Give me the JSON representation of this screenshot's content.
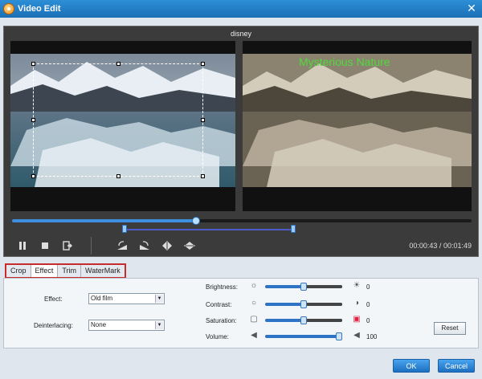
{
  "window": {
    "title": "Video Edit",
    "close_glyph": "✕"
  },
  "preview": {
    "title": "disney",
    "watermark_text": "Mysterious Nature",
    "time_current": "00:00:43",
    "time_separator": "/",
    "time_total": "00:01:49",
    "playback_progress": 0.4
  },
  "tabs": [
    {
      "label": "Crop",
      "active": false
    },
    {
      "label": "Effect",
      "active": true
    },
    {
      "label": "Trim",
      "active": false
    },
    {
      "label": "WaterMark",
      "active": false
    }
  ],
  "effect_panel": {
    "effect_label": "Effect:",
    "effect_value": "Old film",
    "deinterlacing_label": "Deinterlacing:",
    "deinterlacing_value": "None",
    "brightness_label": "Brightness:",
    "brightness_value": "0",
    "brightness_level": 0.5,
    "contrast_label": "Contrast:",
    "contrast_value": "0",
    "contrast_level": 0.5,
    "saturation_label": "Saturation:",
    "saturation_value": "0",
    "saturation_level": 0.5,
    "volume_label": "Volume:",
    "volume_value": "100",
    "volume_level": 1.0,
    "reset_label": "Reset"
  },
  "buttons": {
    "ok_label": "OK",
    "cancel_label": "Cancel"
  },
  "colors": {
    "titlebar": "#1b6fb5",
    "accent": "#2f73c6",
    "watermark": "#4fdb3a",
    "tab_highlight": "#c72c2c"
  },
  "icons": {
    "play_pause": "pause-icon",
    "stop": "stop-icon",
    "snapshot": "snapshot-icon",
    "rotate_left": "rotate-left-icon",
    "rotate_right": "rotate-right-icon",
    "flip_horizontal": "flip-horizontal-icon",
    "flip_vertical": "flip-vertical-icon"
  }
}
